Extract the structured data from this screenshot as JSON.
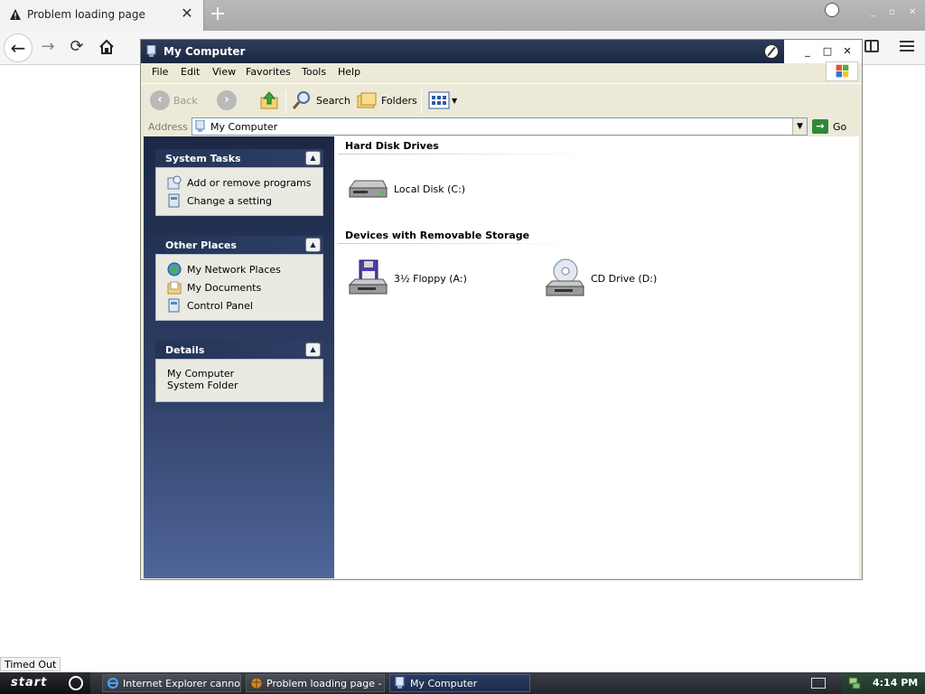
{
  "browser": {
    "tab_title": "Problem loading page",
    "tab_close": "✕",
    "new_tab": "+",
    "status_tip": "Timed Out"
  },
  "window": {
    "title": "My Computer",
    "minimize": "_",
    "maximize": "□",
    "close": "✕"
  },
  "menu": [
    "File",
    "Edit",
    "View",
    "Favorites",
    "Tools",
    "Help"
  ],
  "toolbar": {
    "back": "Back",
    "search": "Search",
    "folders": "Folders"
  },
  "address": {
    "label": "Address",
    "value": "My Computer",
    "go": "Go"
  },
  "task_pane": {
    "system_tasks": {
      "title": "System Tasks",
      "items": [
        "Add or remove programs",
        "Change a setting"
      ]
    },
    "other_places": {
      "title": "Other Places",
      "items": [
        "My Network Places",
        "My Documents",
        "Control Panel"
      ]
    },
    "details": {
      "title": "Details",
      "name": "My Computer",
      "type": "System Folder"
    }
  },
  "content": {
    "hard_disks": {
      "title": "Hard Disk Drives",
      "items": [
        "Local Disk (C:)"
      ]
    },
    "removable": {
      "title": "Devices with Removable Storage",
      "items": [
        "3½ Floppy (A:)",
        "CD Drive (D:)"
      ]
    }
  },
  "taskbar": {
    "start": "start",
    "buttons": [
      "Internet Explorer canno...",
      "Problem loading page - ...",
      "My Computer"
    ],
    "clock": "4:14 PM"
  },
  "colors": {
    "title_bar": "#1b2740",
    "task_pane_top": "#1c2845",
    "task_pane_bottom": "#4f669a",
    "taskbar": "#2b2e35"
  }
}
